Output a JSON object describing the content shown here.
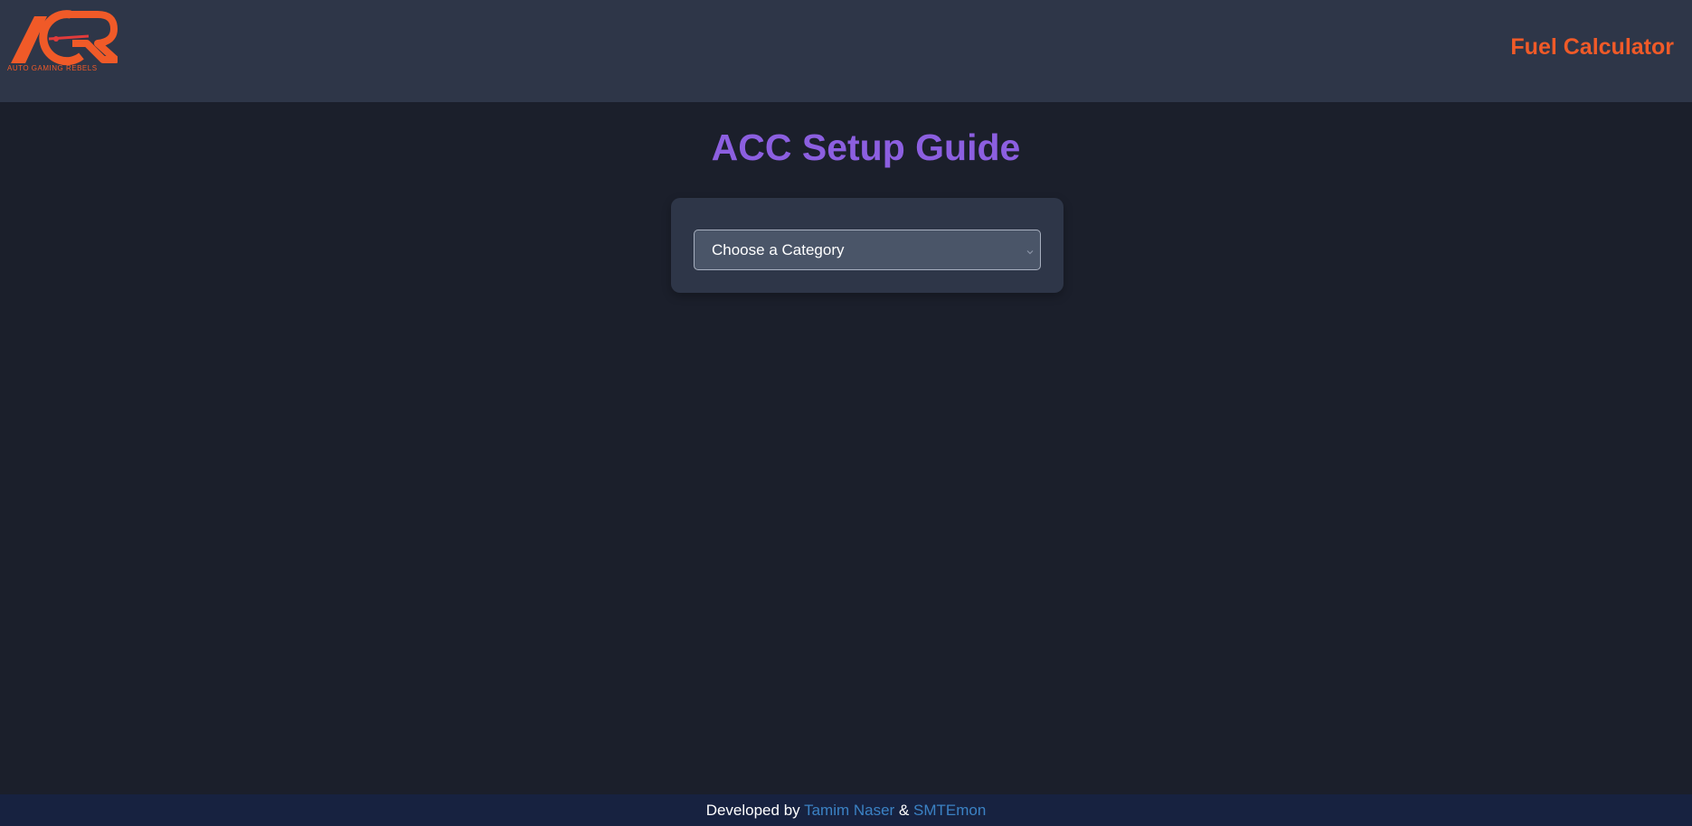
{
  "header": {
    "logo_text": "AUTO GAMING REBELS",
    "nav_link_label": "Fuel Calculator"
  },
  "main": {
    "title": "ACC Setup Guide",
    "category_select": {
      "selected": "Choose a Category"
    }
  },
  "footer": {
    "developed_by": "Developed by",
    "author1": "Tamim Naser",
    "separator": "&",
    "author2": "SMTEmon"
  },
  "colors": {
    "header_bg": "#2e3648",
    "page_bg": "#1b1f2b",
    "accent_orange": "#f05a28",
    "title_purple": "#8c5fe0",
    "link_blue": "#3b82c4",
    "footer_bg": "#172240"
  },
  "icons": {
    "logo": "agr-logo-icon",
    "select_arrow": "chevron-down-icon"
  }
}
